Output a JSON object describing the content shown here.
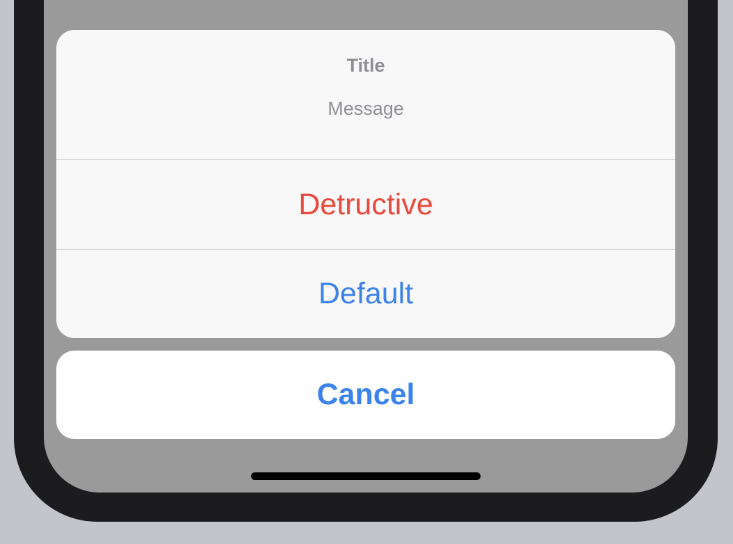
{
  "action_sheet": {
    "title": "Title",
    "message": "Message",
    "actions": [
      {
        "label": "Detructive",
        "style": "destructive"
      },
      {
        "label": "Default",
        "style": "default"
      }
    ],
    "cancel_label": "Cancel"
  },
  "colors": {
    "destructive": "#e9483c",
    "accent": "#3b82ea",
    "dimmed_background": "#9a9a9a",
    "sheet_background": "#f8f8f8",
    "device_frame": "#1c1c1e"
  }
}
